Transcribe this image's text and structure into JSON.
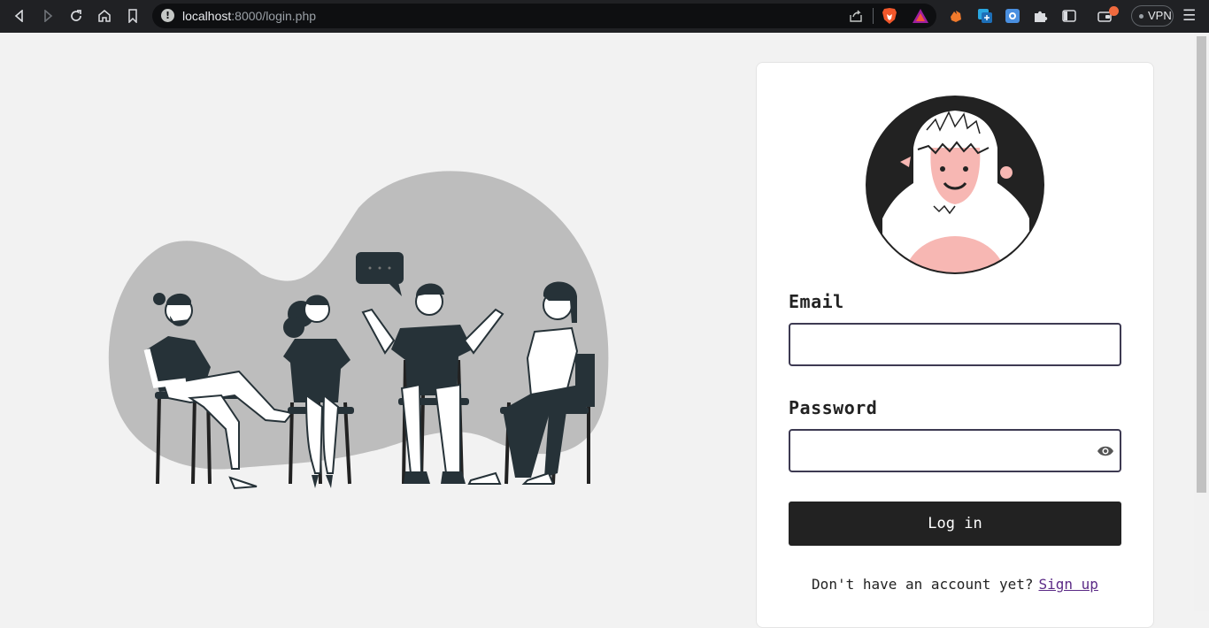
{
  "browser": {
    "url_host": "localhost",
    "url_rest": ":8000/login.php",
    "vpn_label": "VPN"
  },
  "form": {
    "email_label": "Email",
    "email_value": "",
    "password_label": "Password",
    "password_value": "",
    "login_button": "Log in",
    "signup_prompt": "Don't have an account yet?",
    "signup_link": "Sign up"
  },
  "colors": {
    "chrome_bg": "#202124",
    "page_bg": "#f2f2f2",
    "button_bg": "#222222",
    "input_border": "#3d3a52",
    "link": "#5b2a86",
    "avatar_accent": "#f7b7b3"
  }
}
